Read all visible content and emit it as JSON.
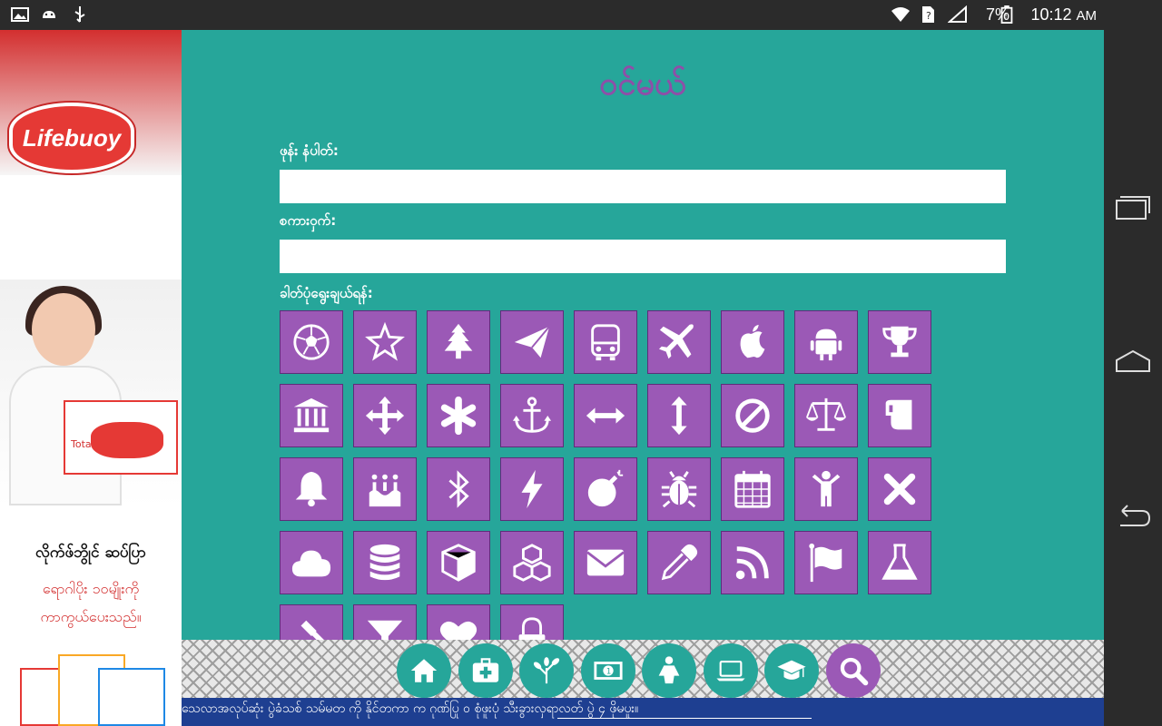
{
  "status_bar": {
    "battery": "7%",
    "time": "10:12",
    "ampm": "AM"
  },
  "ad": {
    "brand": "Lifebuoy",
    "line1": "လိုက်ဖ်ဘွိုင် ဆပ်ပြာ",
    "line2": "ရောဂါပိုး ၁၀မျိုးကို",
    "line3": "ကာကွယ်ပေးသည်။",
    "product": "Total 10"
  },
  "form": {
    "title": "ဝင်မယ်",
    "phone_label": "ဖုန်း နံပါတ်:",
    "phone_value": "",
    "password_label": "စကားဝှက်:",
    "password_value": "",
    "icon_label": "ခါတ်ပုံရွေးချယ်ရန်:"
  },
  "icons": [
    "soccer-ball-icon",
    "star-icon",
    "tree-icon",
    "paper-plane-icon",
    "bus-icon",
    "plane-icon",
    "apple-icon",
    "android-icon",
    "trophy-icon",
    "bank-icon",
    "move-arrows-icon",
    "asterisk-icon",
    "anchor-icon",
    "horizontal-arrows-icon",
    "vertical-arrows-icon",
    "ban-icon",
    "balance-scale-icon",
    "mug-icon",
    "bell-icon",
    "birthday-cake-icon",
    "bluetooth-icon",
    "bolt-icon",
    "bomb-icon",
    "bug-icon",
    "calendar-icon",
    "child-icon",
    "close-icon",
    "cloud-icon",
    "database-icon",
    "cube-icon",
    "cubes-icon",
    "envelope-icon",
    "eyedropper-icon",
    "rss-icon",
    "flag-icon",
    "flask-icon",
    "gavel-icon",
    "filter-icon",
    "heart-icon",
    "lock-icon"
  ],
  "bottom_nav": [
    "home-icon",
    "medical-kit-icon",
    "leaf-icon",
    "money-icon",
    "female-icon",
    "laptop-icon",
    "graduation-cap-icon",
    "search-icon"
  ],
  "ticker": {
    "text": "သေလာအလုပ်ဆုံး ပွဲခံသစ် သမ်မတ ကို နိုင်တကာ က ဂုဏ်ပြု   ၀   စုံဖူးပုံ သီးခွားလှရာလတ် ပွဲ   ၄ ဖိုမပူး။"
  },
  "colors": {
    "teal": "#26a69a",
    "purple": "#9b59b6",
    "ticker_blue": "#1e3f91"
  }
}
